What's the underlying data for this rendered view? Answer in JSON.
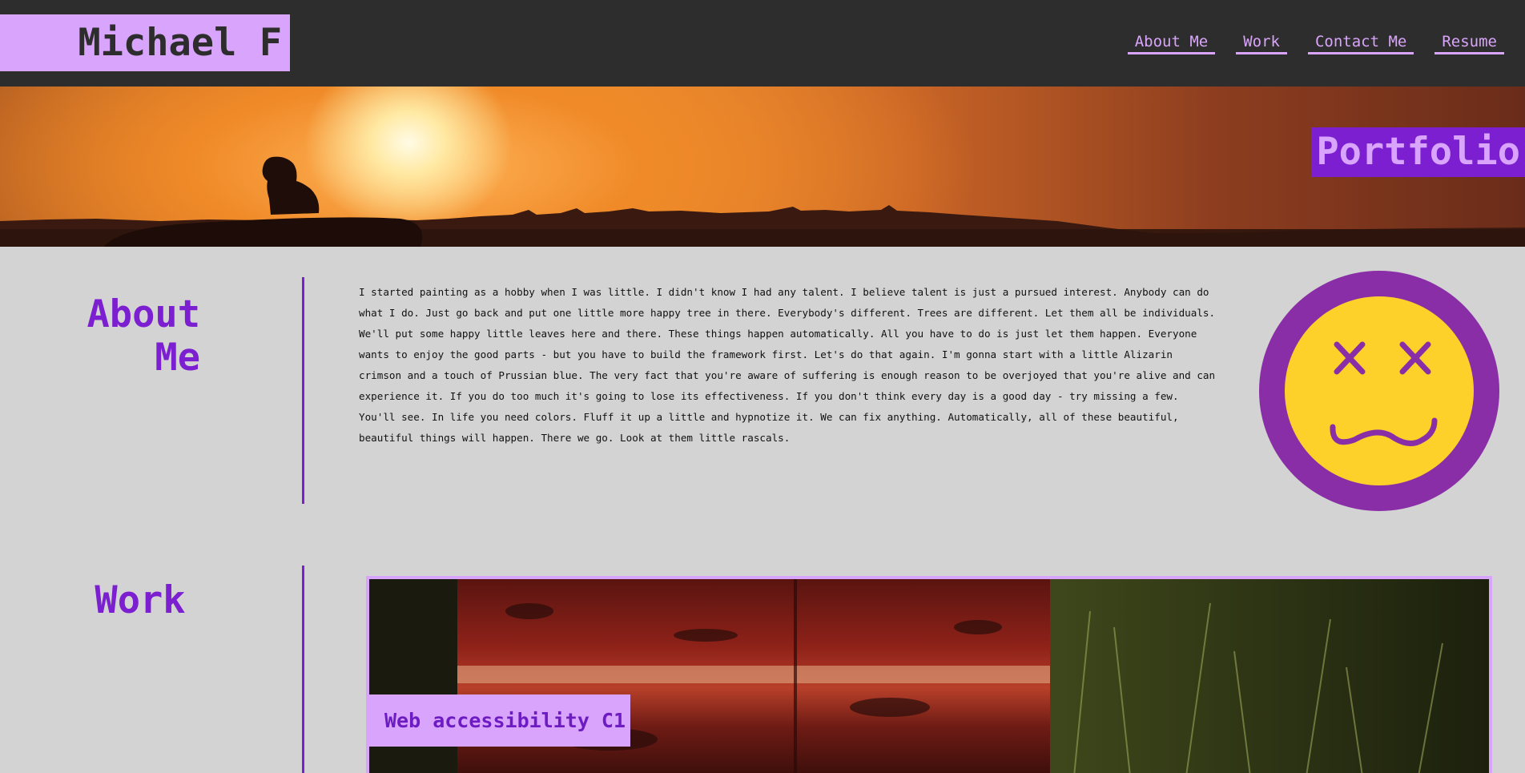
{
  "header": {
    "brand": "Michael F",
    "nav": [
      "About Me",
      "Work",
      "Contact Me",
      "Resume"
    ]
  },
  "hero": {
    "label": "Portfolio"
  },
  "about": {
    "title_line1": "About",
    "title_line2": "Me",
    "text": "I started painting as a hobby when I was little. I didn't know I had any talent. I believe talent is just a pursued interest. Anybody can do what I do. Just go back and put one little more happy tree in there. Everybody's different. Trees are different. Let them all be individuals. We'll put some happy little leaves here and there. These things happen automatically. All you have to do is just let them happen. Everyone wants to enjoy the good parts - but you have to build the framework first. Let's do that again. I'm gonna start with a little Alizarin crimson and a touch of Prussian blue. The very fact that you're aware of suffering is enough reason to be overjoyed that you're alive and can experience it. If you do too much it's going to lose its effectiveness. If you don't think every day is a good day - try missing a few. You'll see. In life you need colors. Fluff it up a little and hypnotize it. We can fix anything. Automatically, all of these beautiful, beautiful things will happen. There we go. Look at them little rascals."
  },
  "work": {
    "title": "Work",
    "card_label": "Web accessibility C1"
  },
  "colors": {
    "accent": "#7b1fd0",
    "accent_light": "#d9a4fb",
    "header_bg": "#2d2d2d",
    "page_bg": "#d3d3d3",
    "smiley_ring": "#892ea6",
    "smiley_face": "#fed02a"
  },
  "icons": {
    "avatar": "dizzy-face-icon"
  }
}
